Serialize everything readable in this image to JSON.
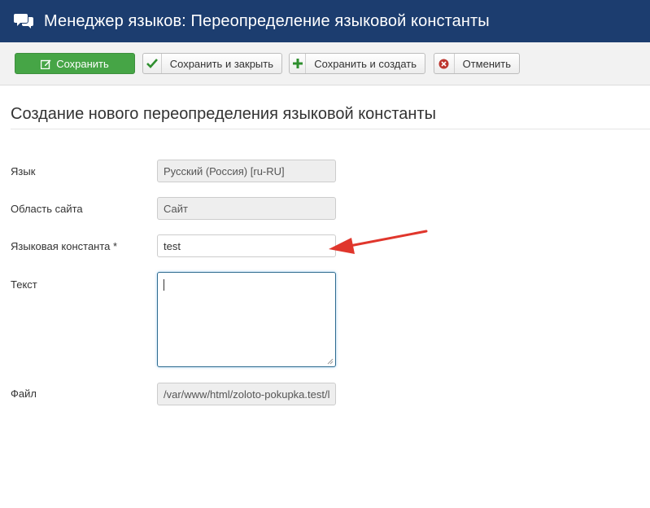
{
  "header": {
    "title": "Менеджер языков: Переопределение языковой константы",
    "logo_icon": "speech-bubbles-icon"
  },
  "toolbar": {
    "save_label": "Сохранить",
    "save_close_label": "Сохранить и закрыть",
    "save_new_label": "Сохранить и создать",
    "cancel_label": "Отменить"
  },
  "page": {
    "heading": "Создание нового переопределения языковой константы"
  },
  "form": {
    "language": {
      "label": "Язык",
      "value": "Русский (Россия) [ru-RU]"
    },
    "client": {
      "label": "Область сайта",
      "value": "Сайт"
    },
    "constant": {
      "label": "Языковая константа *",
      "value": "test"
    },
    "text": {
      "label": "Текст",
      "value": ""
    },
    "file": {
      "label": "Файл",
      "value": "/var/www/html/zoloto-pokupka.test/l"
    }
  },
  "colors": {
    "header_bg": "#1c3d6f",
    "save_green": "#46a546",
    "annotation_arrow": "#e0362c"
  }
}
